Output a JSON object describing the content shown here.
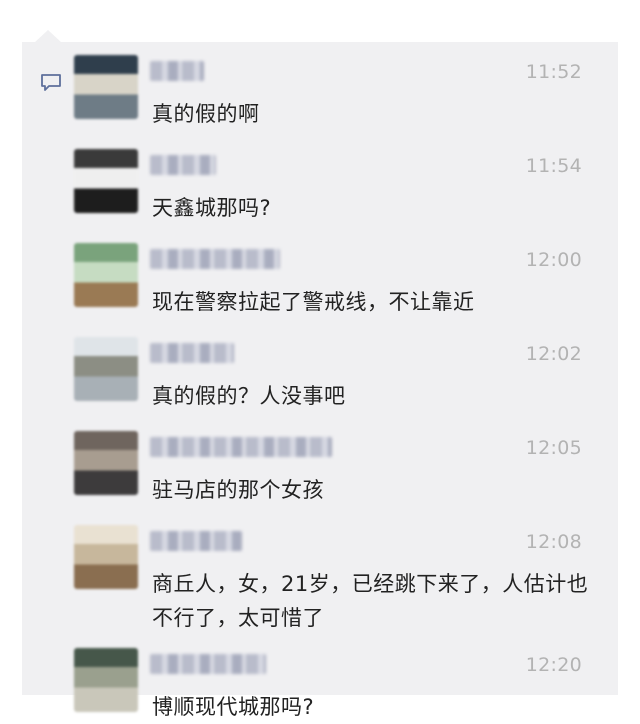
{
  "comments": [
    {
      "time": "11:52",
      "text": "真的假的啊",
      "avatar_colors": [
        "#2f3e4c",
        "#d8d4c8",
        "#6e7c86"
      ]
    },
    {
      "time": "11:54",
      "text": "天鑫城那吗?",
      "avatar_colors": [
        "#3a3a3a",
        "#efefef",
        "#1d1d1d"
      ]
    },
    {
      "time": "12:00",
      "text": "现在警察拉起了警戒线，不让靠近",
      "avatar_colors": [
        "#7aa37c",
        "#c6dcc2",
        "#9a7a54"
      ]
    },
    {
      "time": "12:02",
      "text": "真的假的？人没事吧",
      "avatar_colors": [
        "#dfe4e8",
        "#8c8e84",
        "#a8b0b6"
      ]
    },
    {
      "time": "12:05",
      "text": "驻马店的那个女孩",
      "avatar_colors": [
        "#6f655e",
        "#a89d90",
        "#3d3b3c"
      ]
    },
    {
      "time": "12:08",
      "text": "商丘人，女，21岁，已经跳下来了，人估计也不行了，太可惜了",
      "avatar_colors": [
        "#e9e1d2",
        "#c7b79c",
        "#8a6e50"
      ]
    },
    {
      "time": "12:20",
      "text": "博顺现代城那吗?",
      "avatar_colors": [
        "#46574a",
        "#9aa08e",
        "#c9c7ba"
      ]
    }
  ]
}
